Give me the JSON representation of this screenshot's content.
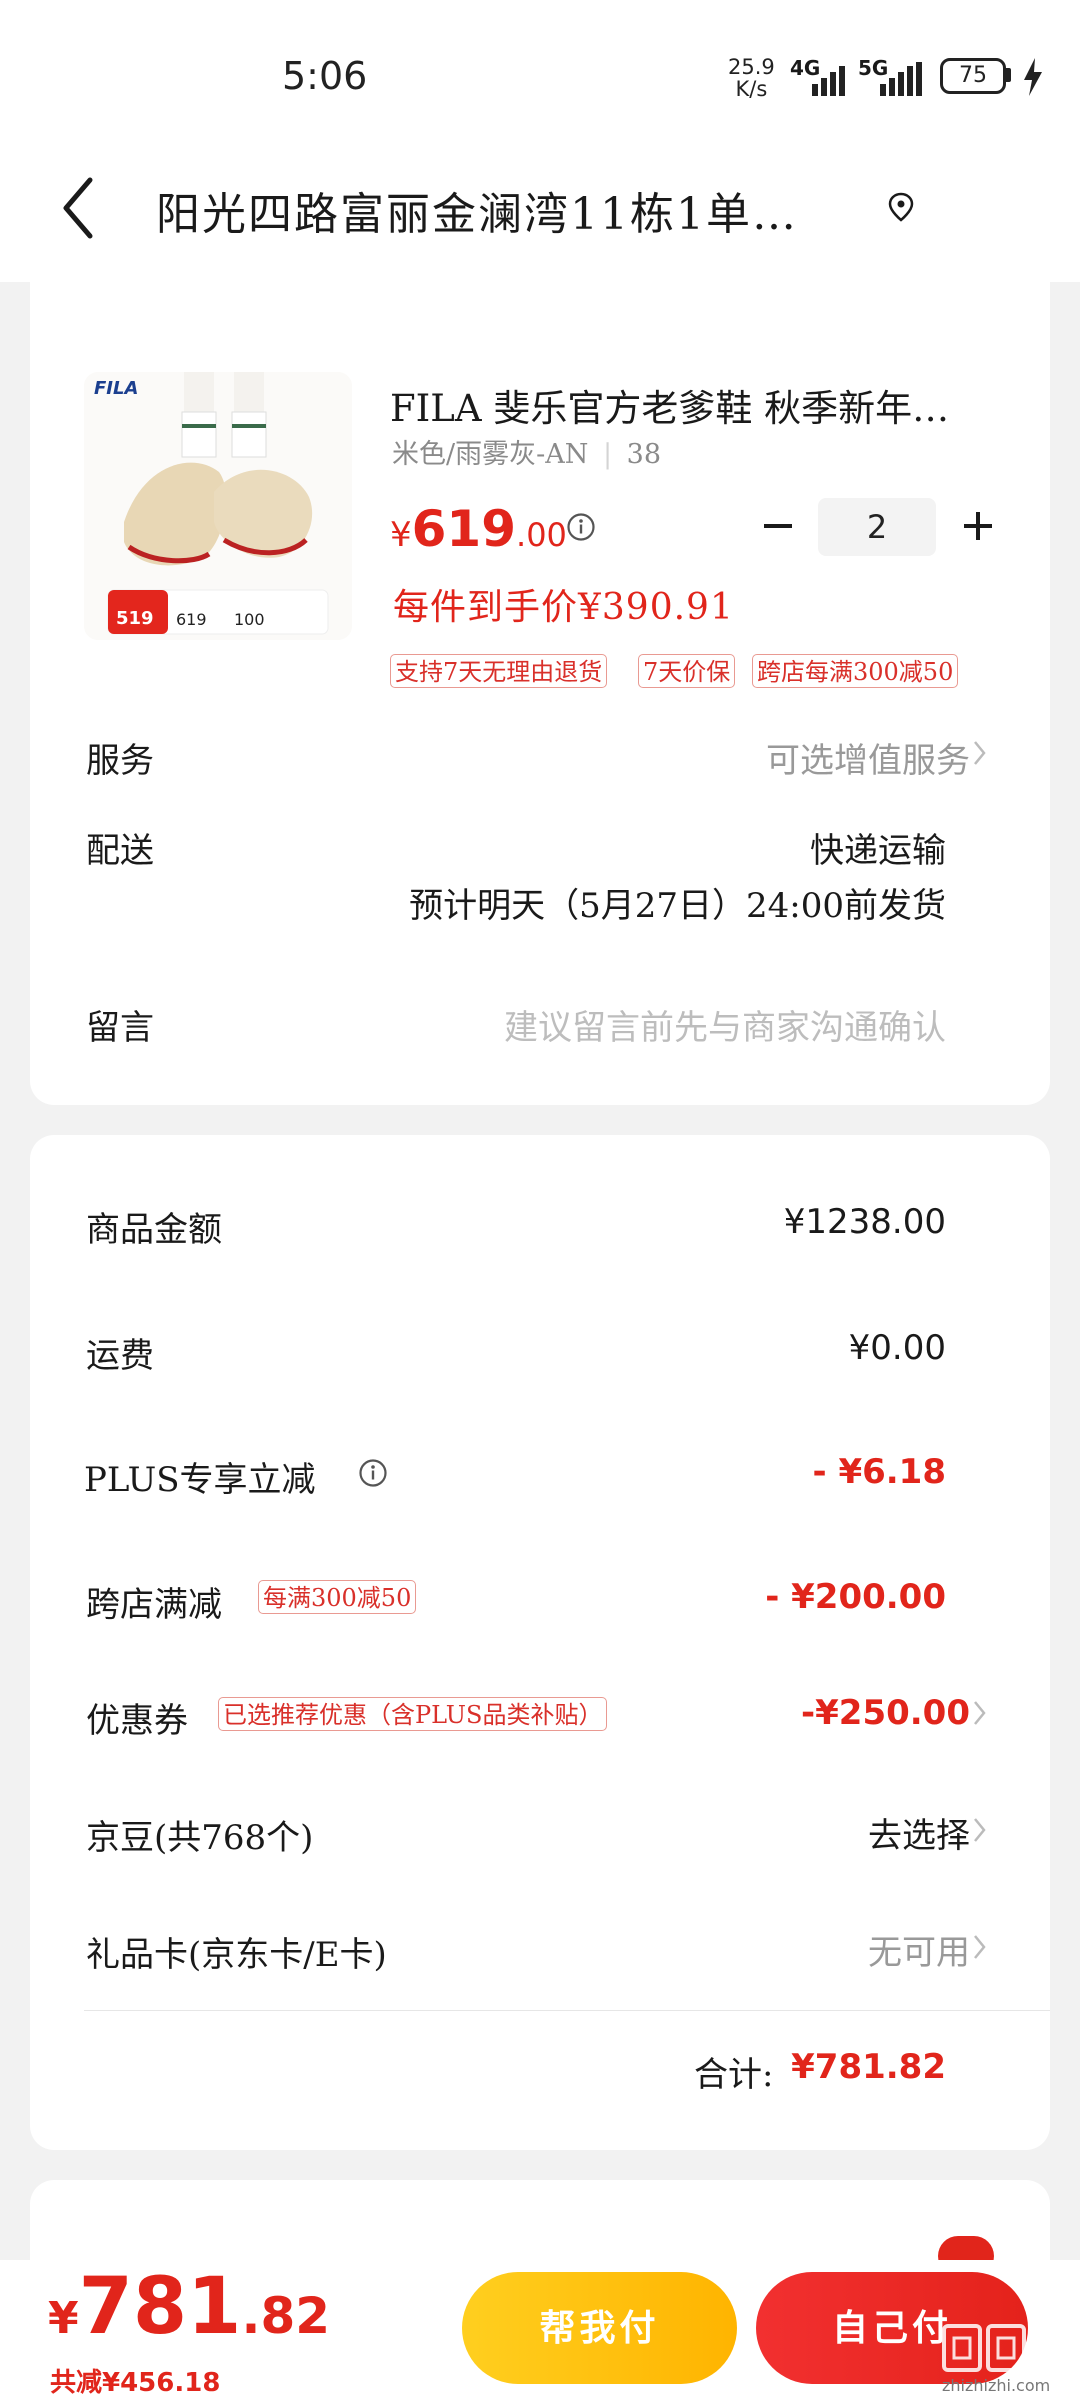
{
  "status_bar": {
    "time": "5:06",
    "net_speed_value": "25.9",
    "net_speed_unit": "K/s",
    "net1": "4G",
    "net2": "5G",
    "battery": "75"
  },
  "header": {
    "address": "阳光四路富丽金澜湾11栋1单…"
  },
  "product": {
    "image_logo": "FILA",
    "image_badge_price": "519",
    "image_badge_a": "619",
    "image_badge_b": "100",
    "title": "FILA 斐乐官方老爹鞋 秋季新年…",
    "spec": "米色/雨雾灰-AN",
    "size": "38",
    "price_symbol": "¥",
    "price_int": "619",
    "price_dec": ".00",
    "quantity": "2",
    "unit_price": "每件到手价¥390.91",
    "tags": [
      "支持7天无理由退货",
      "7天价保",
      "跨店每满300减50"
    ]
  },
  "service": {
    "label": "服务",
    "value": "可选增值服务"
  },
  "delivery": {
    "label": "配送",
    "method": "快递运输",
    "estimate": "预计明天（5月27日）24:00前发货"
  },
  "message": {
    "label": "留言",
    "placeholder": "建议留言前先与商家沟通确认"
  },
  "summary": {
    "goods_label": "商品金额",
    "goods_value": "¥1238.00",
    "shipping_label": "运费",
    "shipping_value": "¥0.00",
    "plus_label": "PLUS专享立减",
    "plus_value": "- ¥6.18",
    "cross_label": "跨店满减",
    "cross_tag": "每满300减50",
    "cross_value": "- ¥200.00",
    "coupon_label": "优惠券",
    "coupon_tag": "已选推荐优惠（含PLUS品类补贴）",
    "coupon_value": "-¥250.00",
    "beans_label": "京豆(共768个)",
    "beans_value": "去选择",
    "gift_label": "礼品卡(京东卡/E卡)",
    "gift_value": "无可用",
    "total_label": "合计:",
    "total_value": "¥781.82"
  },
  "bottom": {
    "price_symbol": "¥",
    "price_int": "781",
    "price_dec": ".82",
    "saved": "共减¥456.18",
    "help_pay": "帮我付",
    "self_pay": "自己付",
    "watermark_text": "zhizhizhi.com"
  },
  "colors": {
    "accent_red": "#e1251b",
    "accent_yellow": "#ffc107",
    "background": "#f2f2f2"
  }
}
